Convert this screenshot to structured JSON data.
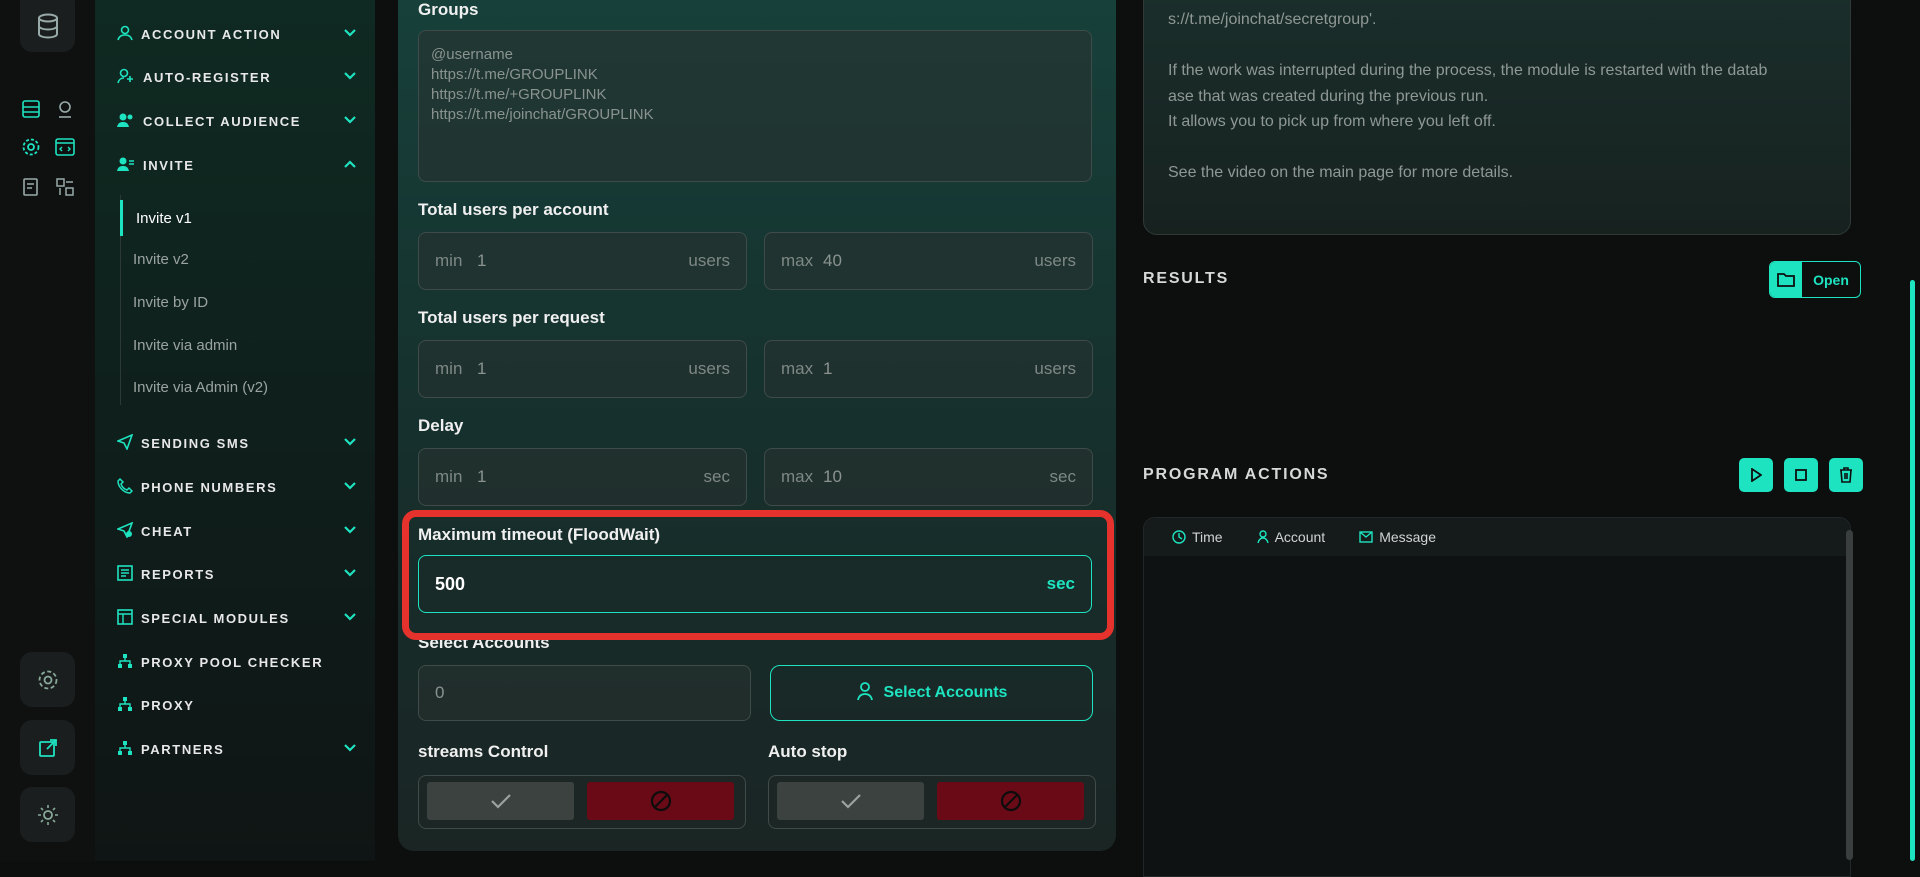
{
  "rail": {
    "icons": [
      "database-icon",
      "server-list-icon",
      "map-pin-icon",
      "gear-icon",
      "code-window-icon",
      "report-icon",
      "apps-icon",
      "settings-icon",
      "external-link-icon",
      "sun-icon"
    ]
  },
  "sidebar": {
    "items": [
      {
        "label": "ACCOUNT ACTION",
        "icon": "user-gear-icon"
      },
      {
        "label": "AUTO-REGISTER",
        "icon": "user-add-icon"
      },
      {
        "label": "COLLECT AUDIENCE",
        "icon": "users-icon"
      },
      {
        "label": "INVITE",
        "icon": "user-invite-icon"
      },
      {
        "label": "SENDING SMS",
        "icon": "send-icon"
      },
      {
        "label": "PHONE NUMBERS",
        "icon": "phone-icon"
      },
      {
        "label": "CHEAT",
        "icon": "boost-icon"
      },
      {
        "label": "REPORTS",
        "icon": "report-icon"
      },
      {
        "label": "SPECIAL MODULES",
        "icon": "module-icon"
      },
      {
        "label": "PROXY POOL CHECKER",
        "icon": "network-icon"
      },
      {
        "label": "PROXY",
        "icon": "network-icon"
      },
      {
        "label": "PARTNERS",
        "icon": "network-icon"
      }
    ],
    "invite_sub": [
      "Invite v1",
      "Invite v2",
      "Invite by ID",
      "Invite via admin",
      "Invite via Admin (v2)"
    ]
  },
  "form": {
    "groups_label": "Groups",
    "groups_placeholder": "@username\nhttps://t.me/GROUPLINK\nhttps://t.me/+GROUPLINK\nhttps://t.me/joinchat/GROUPLINK",
    "total_users_account_label": "Total users per account",
    "tua_min_key": "min",
    "tua_min_val": "1",
    "tua_min_unit": "users",
    "tua_max_key": "max",
    "tua_max_val": "40",
    "tua_max_unit": "users",
    "total_users_request_label": "Total users per request",
    "tur_min_key": "min",
    "tur_min_val": "1",
    "tur_min_unit": "users",
    "tur_max_key": "max",
    "tur_max_val": "1",
    "tur_max_unit": "users",
    "delay_label": "Delay",
    "d_min_key": "min",
    "d_min_val": "1",
    "d_min_unit": "sec",
    "d_max_key": "max",
    "d_max_val": "10",
    "d_max_unit": "sec",
    "timeout_label": "Maximum timeout (FloodWait)",
    "timeout_value": "500",
    "timeout_unit": "sec",
    "select_accounts_label": "Select Accounts",
    "select_accounts_count": "0",
    "select_accounts_button": "Select Accounts",
    "streams_label": "streams Control",
    "autostop_label": "Auto stop"
  },
  "right": {
    "description": "s://t.me/joinchat/secretgroup'.\n\nIf the work was interrupted during the process, the module is restarted with the datab\nase that was created during the previous run.\nIt allows you to pick up from where you left off.\n\nSee the video on the main page for more details.",
    "results_title": "RESULTS",
    "open_label": "Open",
    "actions_title": "PROGRAM ACTIONS",
    "columns": [
      "Time",
      "Account",
      "Message"
    ]
  },
  "colors": {
    "accent": "#1ee3c0",
    "danger": "#e5322d",
    "stop": "#6a0a17"
  }
}
